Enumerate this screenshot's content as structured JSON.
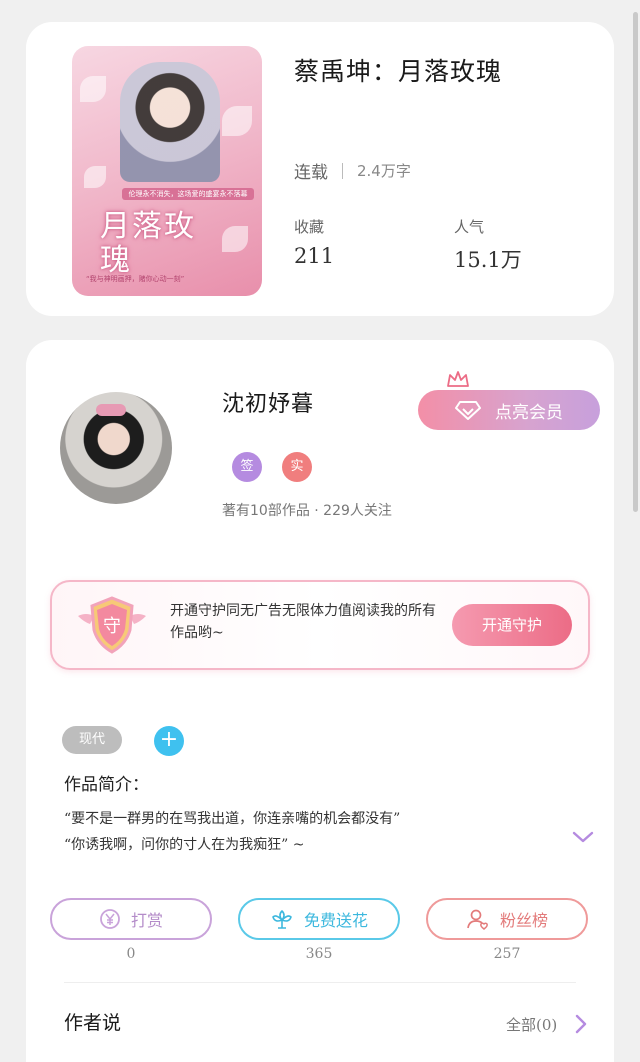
{
  "book": {
    "cover": {
      "tag_strip": "伦理永不消失，这场爱的盛宴永不落幕",
      "title": "月落玫瑰",
      "bottom_line": "“我与神明画押，赌你心动一刻”"
    },
    "title": "蔡禹坤：月落玫瑰",
    "status": "连载",
    "word_count": "2.4万字",
    "stats": [
      {
        "label": "收藏",
        "value": "211"
      },
      {
        "label": "人气",
        "value": "15.1万"
      }
    ]
  },
  "author": {
    "name": "沈初妤暮",
    "badges": [
      {
        "text": "签",
        "color": "#b58be0"
      },
      {
        "text": "实",
        "color": "#f07e7e"
      }
    ],
    "stats_line": "著有10部作品 · 229人关注",
    "vip_label": "点亮会员"
  },
  "guard": {
    "shield_text": "守",
    "text": "开通守护同无广告无限体力值阅读我的所有作品哟~",
    "button_label": "开通守护"
  },
  "tags": {
    "items": [
      "现代"
    ],
    "add_symbol": "+"
  },
  "intro": {
    "label": "作品简介：",
    "lines": [
      "“要不是一群男的在骂我出道，你连亲嘴的机会都没有”",
      "“你诱我啊，问你的寸人在为我痴狂” ~"
    ]
  },
  "actions": [
    {
      "label": "打赏",
      "count": "0",
      "icon": "yen-coin-icon"
    },
    {
      "label": "免费送花",
      "count": "365",
      "icon": "flower-icon"
    },
    {
      "label": "粉丝榜",
      "count": "257",
      "icon": "fan-user-icon"
    }
  ],
  "author_says": {
    "title": "作者说",
    "all_label": "全部(0)"
  },
  "colors": {
    "accent_pink": "#ec6c86",
    "purple": "#b58be0",
    "cyan": "#3fc1ef",
    "card_bg": "#ffffff",
    "page_bg": "#f0f0f0"
  }
}
